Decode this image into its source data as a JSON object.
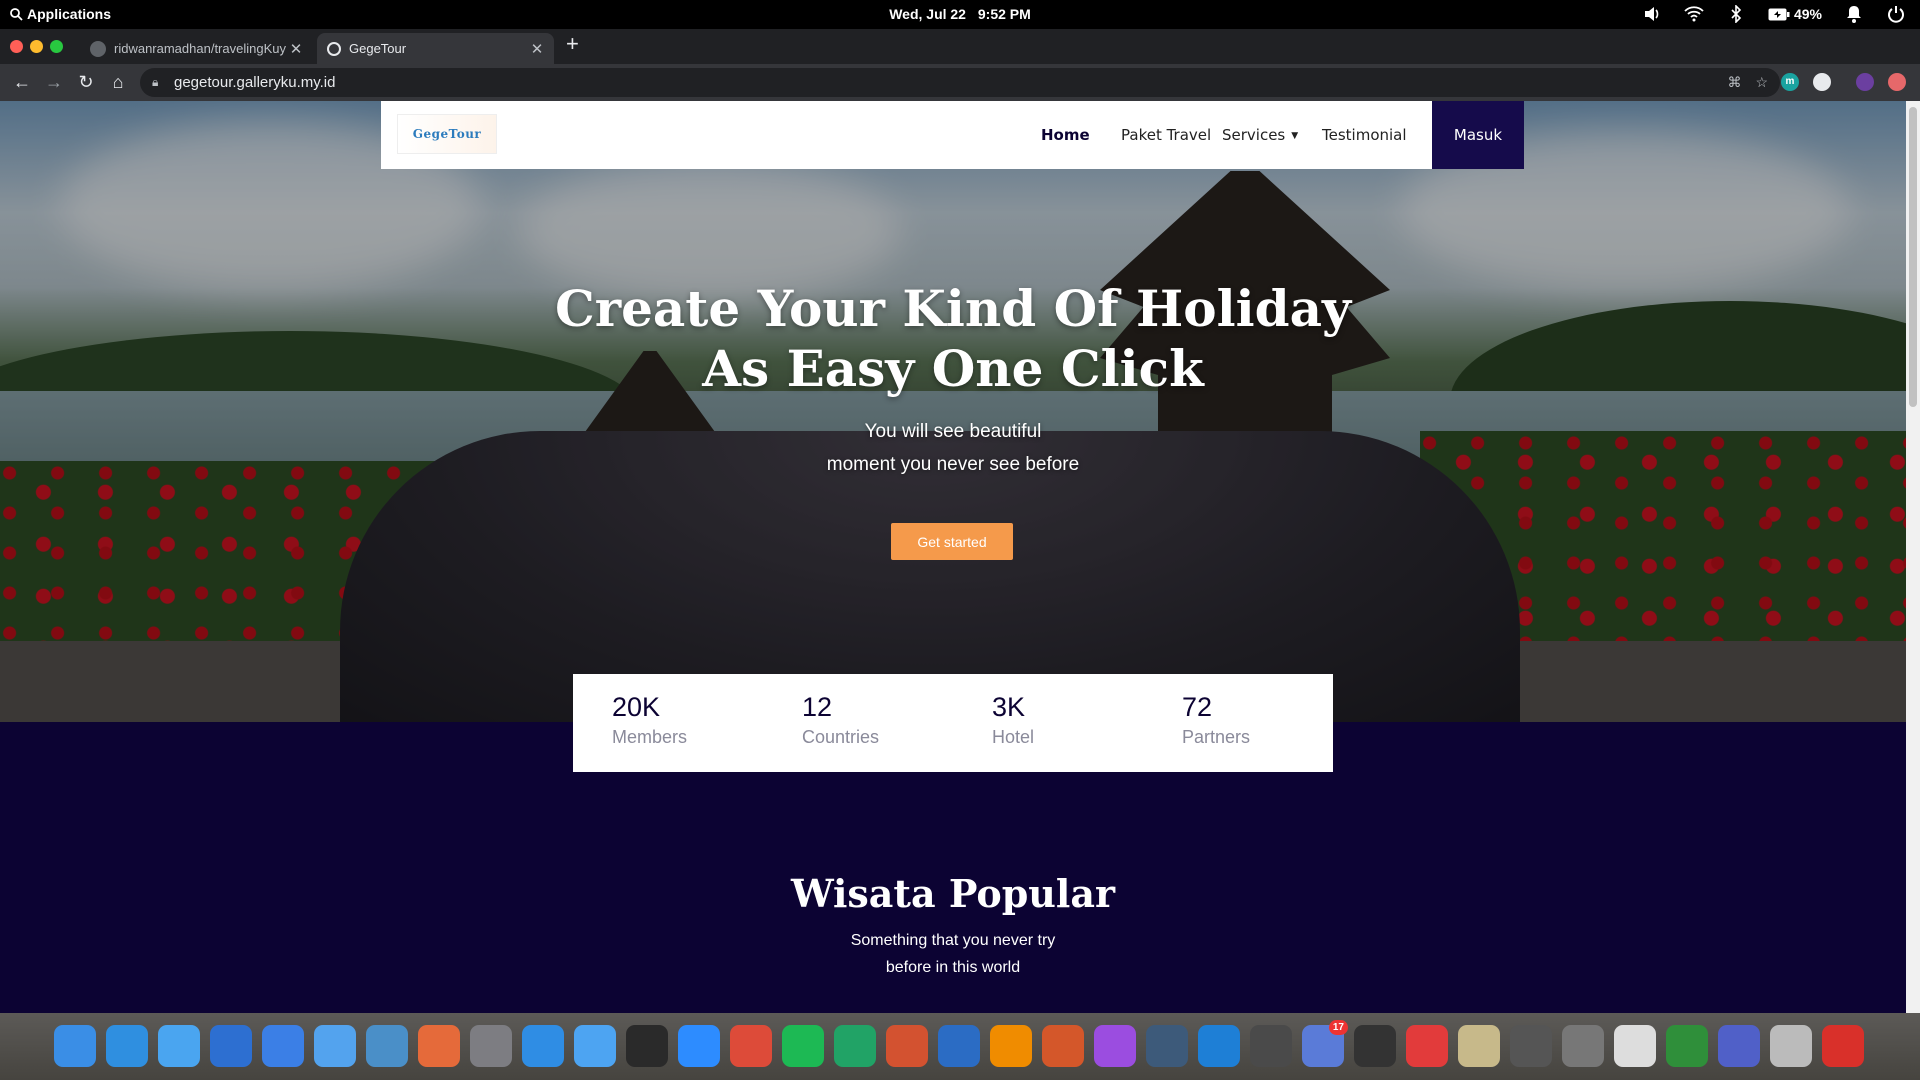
{
  "topbar": {
    "applications": "Applications",
    "date": "Wed, Jul 22",
    "time": "9:52 PM",
    "battery": "49%"
  },
  "browser": {
    "tabs": [
      {
        "title": "ridwanramadhan/travelingKuy",
        "active": false
      },
      {
        "title": "GegeTour",
        "active": true
      }
    ],
    "url": "gegetour.galleryku.my.id",
    "extensions": [
      {
        "name": "m-extension-icon",
        "label": "m",
        "color": "#1aa3a0"
      },
      {
        "name": "shield-extension-icon",
        "label": "",
        "color": "#e8eaed"
      },
      {
        "name": "profile-avatar",
        "label": "",
        "color": "#6b3fa0"
      },
      {
        "name": "update-extension-icon",
        "label": "",
        "color": "#e6686a"
      }
    ]
  },
  "site": {
    "logo_text": "GegeTour",
    "nav": {
      "home": "Home",
      "paket": "Paket Travel",
      "services": "Services",
      "testimonial": "Testimonial",
      "masuk": "Masuk"
    },
    "hero": {
      "title_line1": "Create Your Kind Of Holiday",
      "title_line2": "As Easy One Click",
      "sub_line1": "You will see beautiful",
      "sub_line2": "moment you never see before",
      "cta": "Get started"
    },
    "stats": [
      {
        "value": "20K",
        "label": "Members"
      },
      {
        "value": "12",
        "label": "Countries"
      },
      {
        "value": "3K",
        "label": "Hotel"
      },
      {
        "value": "72",
        "label": "Partners"
      }
    ],
    "popular": {
      "title": "Wisata Popular",
      "sub_line1": "Something that you never try",
      "sub_line2": "before in this world"
    }
  },
  "dock": [
    {
      "name": "launchpad-icon",
      "color": "#3a8ee6",
      "badge": ""
    },
    {
      "name": "safari-icon",
      "color": "#2f8fe0",
      "badge": ""
    },
    {
      "name": "notes-icon",
      "color": "#4aa5f0",
      "badge": ""
    },
    {
      "name": "calendar-icon",
      "color": "#2d6fd1",
      "badge": ""
    },
    {
      "name": "music-icon",
      "color": "#3b7fe6",
      "badge": ""
    },
    {
      "name": "video-icon",
      "color": "#53a3ee",
      "badge": ""
    },
    {
      "name": "camera-icon",
      "color": "#4a8fc8",
      "badge": ""
    },
    {
      "name": "photos-icon",
      "color": "#e56a3a",
      "badge": ""
    },
    {
      "name": "settings-icon",
      "color": "#7d7d82",
      "badge": ""
    },
    {
      "name": "download-icon",
      "color": "#2f8de4",
      "badge": ""
    },
    {
      "name": "finder-icon",
      "color": "#4da4f2",
      "badge": ""
    },
    {
      "name": "terminal-icon",
      "color": "#2a2a2a",
      "badge": ""
    },
    {
      "name": "zoom-icon",
      "color": "#2d8cff",
      "badge": ""
    },
    {
      "name": "chrome-icon",
      "color": "#dd4b39",
      "badge": ""
    },
    {
      "name": "spotify-icon",
      "color": "#1db954",
      "badge": ""
    },
    {
      "name": "spreadsheet-icon",
      "color": "#21a366",
      "badge": ""
    },
    {
      "name": "presentation-icon",
      "color": "#d35230",
      "badge": ""
    },
    {
      "name": "writer-icon",
      "color": "#2b6cc4",
      "badge": ""
    },
    {
      "name": "vlc-icon",
      "color": "#f08c00",
      "badge": ""
    },
    {
      "name": "gitkraken-icon",
      "color": "#d4572a",
      "badge": ""
    },
    {
      "name": "krita-icon",
      "color": "#9b4de0",
      "badge": ""
    },
    {
      "name": "steam-icon",
      "color": "#3d5a7a",
      "badge": ""
    },
    {
      "name": "vscode-icon",
      "color": "#1e7fd6",
      "badge": ""
    },
    {
      "name": "sublime-icon",
      "color": "#4a4a4a",
      "badge": ""
    },
    {
      "name": "discord-icon",
      "color": "#5a7bd8",
      "badge": "17"
    },
    {
      "name": "screen-recorder-icon",
      "color": "#333",
      "badge": ""
    },
    {
      "name": "record-icon",
      "color": "#e23b3b",
      "badge": ""
    },
    {
      "name": "paint-brush-icon",
      "color": "#c7b98a",
      "badge": ""
    },
    {
      "name": "monitor-icon",
      "color": "#555",
      "badge": ""
    },
    {
      "name": "scissors-icon",
      "color": "#777",
      "badge": ""
    },
    {
      "name": "clock-icon",
      "color": "#ddd",
      "badge": ""
    },
    {
      "name": "globe-icon",
      "color": "#2f8f3a",
      "badge": ""
    },
    {
      "name": "window-icon",
      "color": "#5060c8",
      "badge": ""
    },
    {
      "name": "trash-icon",
      "color": "#bbb",
      "badge": ""
    },
    {
      "name": "pdf-icon",
      "color": "#d9302a",
      "badge": ""
    }
  ]
}
